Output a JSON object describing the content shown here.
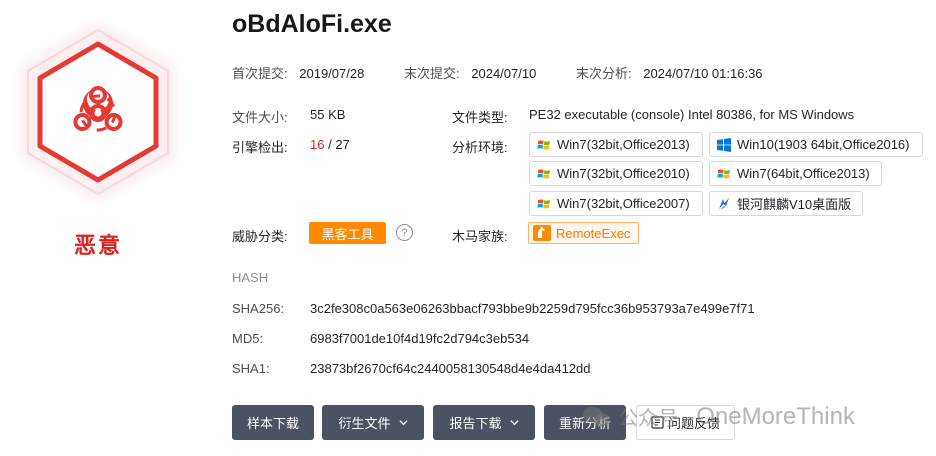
{
  "file": {
    "name": "oBdAloFi.exe"
  },
  "verdict": {
    "label": "恶意",
    "icon": "biohazard-icon",
    "color": "#e02020"
  },
  "meta": {
    "first_submit_label": "首次提交:",
    "first_submit": "2019/07/28",
    "last_submit_label": "末次提交:",
    "last_submit": "2024/07/10",
    "last_analysis_label": "末次分析:",
    "last_analysis": "2024/07/10 01:16:36"
  },
  "details": {
    "size_label": "文件大小:",
    "size": "55 KB",
    "type_label": "文件类型:",
    "type": "PE32 executable (console) Intel 80386, for MS Windows",
    "engine_label": "引擎检出:",
    "engine_detected": "16",
    "engine_sep": " / ",
    "engine_total": "27",
    "env_label": "分析环境:",
    "threat_label": "威胁分类:",
    "threat_tag": "黑客工具",
    "help_glyph": "?",
    "family_label": "木马家族:",
    "family": "RemoteExec"
  },
  "environments": [
    {
      "label": "Win7(32bit,Office2013)",
      "icon": "windows-xp-flag-icon"
    },
    {
      "label": "Win10(1903 64bit,Office2016)",
      "icon": "windows-10-logo-icon"
    },
    {
      "label": "Win7(32bit,Office2010)",
      "icon": "windows-xp-flag-icon"
    },
    {
      "label": "Win7(64bit,Office2013)",
      "icon": "windows-xp-flag-icon"
    },
    {
      "label": "Win7(32bit,Office2007)",
      "icon": "windows-xp-flag-icon"
    },
    {
      "label": "银河麒麟V10桌面版",
      "icon": "kylin-logo-icon"
    }
  ],
  "hash": {
    "title": "HASH",
    "sha256_label": "SHA256:",
    "sha256": "3c2fe308c0a563e06263bbacf793bbe9b2259d795fcc36b953793a7e499e7f71",
    "md5_label": "MD5:",
    "md5": "6983f7001de10f4d19fc2d794c3eb534",
    "sha1_label": "SHA1:",
    "sha1": "23873bf2670cf64c2440058130548d4e4da412dd"
  },
  "actions": {
    "download_sample": "样本下载",
    "derived_files": "衍生文件",
    "report_download": "报告下载",
    "reanalyze": "重新分析",
    "feedback": "问题反馈"
  },
  "watermark": {
    "cn": "公众号 ·",
    "en": "OneMoreThink"
  },
  "colors": {
    "danger": "#e02020",
    "accent_orange": "#ff8a00",
    "button_dark": "#4b5261"
  }
}
